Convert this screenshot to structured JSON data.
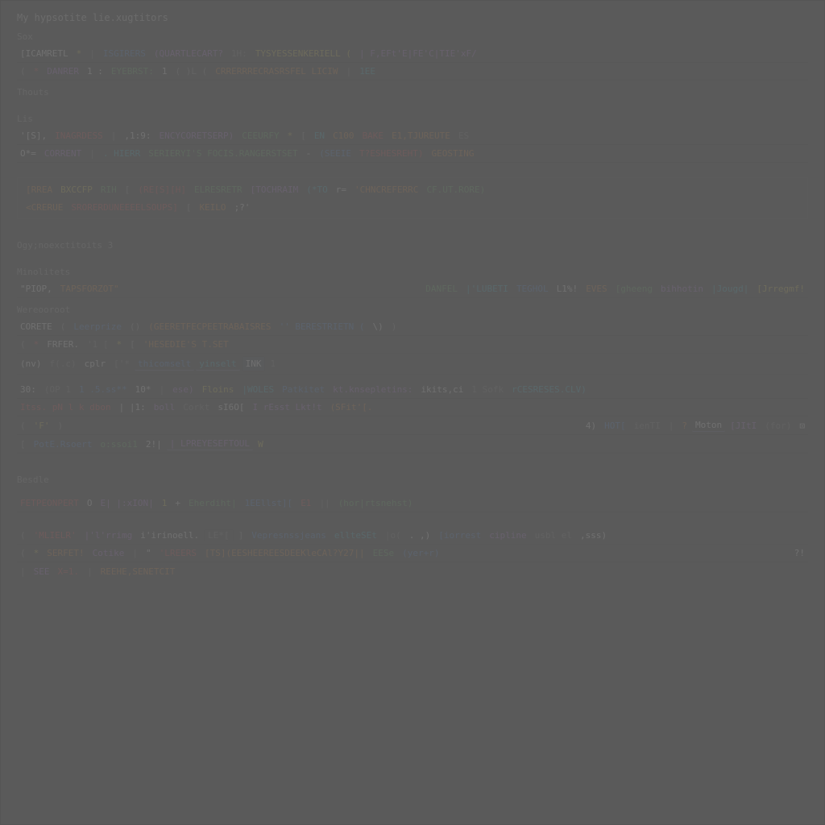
{
  "header": "My hypsotite lie.xugtitors",
  "sections": {
    "sox": "Sox",
    "sox_lines": [
      [
        {
          "t": "[ICAMRETL",
          "c": "t-white"
        },
        {
          "t": "*",
          "c": "t-yellow"
        },
        {
          "t": "|",
          "c": "t-gray"
        },
        {
          "t": "ISGIRERS",
          "c": "t-blue"
        },
        {
          "t": "(QUARTLECART?",
          "c": "t-purple"
        },
        {
          "t": "1H:",
          "c": "t-gray"
        },
        {
          "t": "TYSYESSENKERIELL (",
          "c": "t-yellow"
        },
        {
          "t": "| F,EFt'E|FE'C|TIE'xF/",
          "c": "t-purple"
        }
      ],
      [
        {
          "t": "(",
          "c": "paren"
        },
        {
          "t": "*",
          "c": "t-red"
        },
        {
          "t": "DANRER",
          "c": "t-purple"
        },
        {
          "t": "1 :",
          "c": "t-white"
        },
        {
          "t": "EYEBRST:",
          "c": "t-green"
        },
        {
          "t": "1",
          "c": "t-white"
        },
        {
          "t": "( )L (",
          "c": "paren"
        },
        {
          "t": "CRRERRRECRASRSFEL LICIW",
          "c": "t-orange"
        },
        {
          "t": "|",
          "c": "t-gray"
        },
        {
          "t": "1EE",
          "c": "t-cyan"
        }
      ]
    ],
    "thouts": "Thouts",
    "lis_label": "Lis",
    "lis_lines": [
      [
        {
          "t": "'[S],",
          "c": "t-white"
        },
        {
          "t": "INAGRDESS",
          "c": "t-red"
        },
        {
          "t": "|",
          "c": "t-gray"
        },
        {
          "t": ",1:9:",
          "c": "t-white"
        },
        {
          "t": "ENCYCORETSERP)",
          "c": "t-purple"
        },
        {
          "t": "CEEURFY",
          "c": "t-green"
        },
        {
          "t": "*",
          "c": "t-yellow"
        },
        {
          "t": "[",
          "c": "paren"
        },
        {
          "t": "EN",
          "c": "t-cyan"
        },
        {
          "t": "C100",
          "c": "t-orange"
        },
        {
          "t": "BAKE",
          "c": "t-red"
        },
        {
          "t": "E1,TJUREUTE",
          "c": "t-orange"
        },
        {
          "t": "ES",
          "c": "t-gray"
        }
      ],
      [
        {
          "t": "O*=",
          "c": "t-white"
        },
        {
          "t": "CORRENT",
          "c": "t-purple"
        },
        {
          "t": "|",
          "c": "t-gray"
        },
        {
          "t": ". HIERR",
          "c": "t-cyan"
        },
        {
          "t": "SERIERYI'S FOCIS.RANGERSTSET",
          "c": "t-green"
        },
        {
          "t": "-",
          "c": "t-white"
        },
        {
          "t": "(SEEIE",
          "c": "t-blue"
        },
        {
          "t": "T?ESHESREHT)",
          "c": "t-red"
        },
        {
          "t": "GEOSTING",
          "c": "t-orange"
        }
      ]
    ],
    "highlighted_block": [
      [
        {
          "t": "[RREA",
          "c": "t-orange"
        },
        {
          "t": "BXCCFP",
          "c": "t-yellow"
        },
        {
          "t": "RIH",
          "c": "t-green"
        },
        {
          "t": "[",
          "c": "paren"
        },
        {
          "t": "(RE[S][H]",
          "c": "t-red"
        },
        {
          "t": "ELRESRETR",
          "c": "t-green"
        },
        {
          "t": "[TOCHRAIM",
          "c": "t-purple"
        },
        {
          "t": "(*TO",
          "c": "t-cyan"
        },
        {
          "t": "r=",
          "c": "t-white"
        },
        {
          "t": "'CHNCREFERRC",
          "c": "t-orange"
        },
        {
          "t": "CF.UT.RORE)",
          "c": "t-green"
        }
      ],
      [
        {
          "t": "<CRERUE",
          "c": "t-orange"
        },
        {
          "t": "SRORERDUNEEEELSOUPS]",
          "c": "t-red"
        },
        {
          "t": "[",
          "c": "paren"
        },
        {
          "t": "KEILO",
          "c": "t-orange"
        },
        {
          "t": ";?'",
          "c": "t-white"
        }
      ]
    ],
    "ognexctions": "Ogy;noexctitoits 3",
    "mnoilets": "Minolitets",
    "mnoilets_lines": [
      [
        {
          "t": "\"PIOP,",
          "c": "t-white"
        },
        {
          "t": "TAPSFORZOT\"",
          "c": "t-orange"
        },
        {
          "t": "DANFEL",
          "c": "t-green",
          "right": true
        },
        {
          "t": "|'LUBETI",
          "c": "t-cyan"
        },
        {
          "t": "TEGHOL",
          "c": "t-blue"
        },
        {
          "t": "L1%!",
          "c": "t-white"
        },
        {
          "t": "EVES",
          "c": "t-orange"
        },
        {
          "t": "[gheeng",
          "c": "t-green"
        },
        {
          "t": "bihhotin",
          "c": "t-purple"
        },
        {
          "t": "|Jougd|",
          "c": "t-cyan"
        },
        {
          "t": "[Jrregmf!",
          "c": "t-yellow"
        }
      ]
    ],
    "weroorook": "Wereooroot",
    "weroorook_line": [
      {
        "t": "CORETE",
        "c": "t-white"
      },
      {
        "t": "(",
        "c": "paren"
      },
      {
        "t": "Leerprize",
        "c": "t-blue"
      },
      {
        "t": "()",
        "c": "paren"
      },
      {
        "t": "(GEERETFECPEETRABAISRES",
        "c": "t-orange"
      },
      {
        "t": "'' BERESTRIETN (",
        "c": "t-blue"
      },
      {
        "t": "\\)",
        "c": "t-white"
      },
      {
        "t": ")",
        "c": "paren"
      }
    ],
    "morelines": [
      [
        {
          "t": "(",
          "c": "paren"
        },
        {
          "t": "*",
          "c": "t-red"
        },
        {
          "t": "FRFER.",
          "c": "t-white"
        },
        {
          "t": "'1 [",
          "c": "t-gray"
        },
        {
          "t": "*",
          "c": "t-yellow"
        },
        {
          "t": "[",
          "c": "paren"
        },
        {
          "t": "'HESEDIE'S T.SET",
          "c": "t-orange"
        }
      ],
      [
        {
          "t": "(nv)",
          "c": "t-white"
        },
        {
          "t": "f(.c)",
          "c": "t-gray"
        },
        {
          "t": "cplr",
          "c": "t-white"
        },
        {
          "t": "['*",
          "c": "t-gray box"
        },
        {
          "t": "thicomselt",
          "c": "t-blue t-underline"
        },
        {
          "t": "yinselt",
          "c": "t-cyan t-underline"
        },
        {
          "t": "INK",
          "c": "t-white t-box",
          "highlight": true
        },
        {
          "t": "1",
          "c": "t-gray"
        }
      ]
    ],
    "midlines": [
      [
        {
          "t": "30:",
          "c": "t-white"
        },
        {
          "t": "(OP 1",
          "c": "t-gray"
        },
        {
          "t": "1 .5.ss**",
          "c": "t-blue"
        },
        {
          "t": "10*",
          "c": "t-white"
        },
        {
          "t": "|",
          "c": "t-gray"
        },
        {
          "t": "ese)",
          "c": "t-purple"
        },
        {
          "t": "Floins",
          "c": "t-yellow"
        },
        {
          "t": "|WOLES",
          "c": "t-cyan"
        },
        {
          "t": "Patkitet",
          "c": "t-blue"
        },
        {
          "t": "kt.knsepletins:",
          "c": "t-purple"
        },
        {
          "t": "ikits,ci",
          "c": "t-white"
        },
        {
          "t": "1 Sofk",
          "c": "t-gray"
        },
        {
          "t": "rCESRESES.CLV)",
          "c": "t-cyan"
        }
      ],
      [
        {
          "t": "Itss. pN l k dbon",
          "c": "t-red"
        },
        {
          "t": "| |1:",
          "c": "t-white"
        },
        {
          "t": "boll",
          "c": "t-purple"
        },
        {
          "t": "Corkt",
          "c": "t-gray"
        },
        {
          "t": "sI6O[",
          "c": "t-white"
        },
        {
          "t": "I rEsst Lkt!t",
          "c": "t-purple"
        },
        {
          "t": "(SFit'[.",
          "c": "t-orange"
        }
      ],
      [
        {
          "t": "(",
          "c": "paren"
        },
        {
          "t": "'F'",
          "c": "t-yellow"
        },
        {
          "t": ")",
          "c": "paren"
        },
        {
          "t": "4)",
          "c": "t-white",
          "right": true
        },
        {
          "t": "HOT[",
          "c": "t-blue"
        },
        {
          "t": "ienTI",
          "c": "t-gray"
        },
        {
          "t": "|",
          "c": "t-gray"
        },
        {
          "t": "?",
          "c": "t-orange"
        },
        {
          "t": "Moton",
          "c": "t-white t-underline"
        },
        {
          "t": "[JItI",
          "c": "t-purple"
        },
        {
          "t": "(for)",
          "c": "t-gray"
        },
        {
          "t": "⊡",
          "c": "t-white icon",
          "icon": true
        }
      ],
      [
        {
          "t": "[",
          "c": "paren"
        },
        {
          "t": "PotE.Rsoert",
          "c": "t-blue"
        },
        {
          "t": "o:ssoi1",
          "c": "t-green"
        },
        {
          "t": "2!|",
          "c": "t-white"
        },
        {
          "t": "| LPREYESEFTOUL",
          "c": "t-purple t-underline"
        },
        {
          "t": "W",
          "c": "t-yellow"
        }
      ]
    ],
    "besdle": "Besdle",
    "besdle_line": [
      {
        "t": "FETPEONPERT",
        "c": "t-red"
      },
      {
        "t": "O",
        "c": "t-white"
      },
      {
        "t": "E| |:xION|",
        "c": "t-purple"
      },
      {
        "t": "1",
        "c": "t-yellow"
      },
      {
        "t": "+",
        "c": "t-white"
      },
      {
        "t": "Eherdiht|",
        "c": "t-green"
      },
      {
        "t": "1EEllst][",
        "c": "t-blue"
      },
      {
        "t": "E1",
        "c": "t-red"
      },
      {
        "t": "||",
        "c": "t-gray"
      },
      {
        "t": "(hor|rtsnehst)",
        "c": "t-green"
      }
    ],
    "bottom_lines": [
      [
        {
          "t": "(",
          "c": "paren"
        },
        {
          "t": "'MLIELR'",
          "c": "t-red"
        },
        {
          "t": "|'l'rrimg",
          "c": "t-purple"
        },
        {
          "t": "i'irinoell.",
          "c": "t-white"
        },
        {
          "t": "LE*[",
          "c": "t-gray t-box"
        },
        {
          "t": "]",
          "c": "paren"
        },
        {
          "t": "Vepresnssjeans",
          "c": "t-blue"
        },
        {
          "t": "ellteSEt",
          "c": "t-cyan"
        },
        {
          "t": "|o(",
          "c": "t-gray"
        },
        {
          "t": ". ,)",
          "c": "t-white"
        },
        {
          "t": "[iorrest",
          "c": "t-blue"
        },
        {
          "t": "cipline",
          "c": "t-purple"
        },
        {
          "t": "usbl el",
          "c": "t-gray"
        },
        {
          "t": ",sss)",
          "c": "t-white"
        }
      ],
      [
        {
          "t": "(",
          "c": "paren"
        },
        {
          "t": "*",
          "c": "t-yellow"
        },
        {
          "t": "SERFET!",
          "c": "t-orange"
        },
        {
          "t": "Cotike",
          "c": "t-purple"
        },
        {
          "t": "|",
          "c": "t-gray"
        },
        {
          "t": "\"",
          "c": "t-white"
        },
        {
          "t": "'LREERS",
          "c": "t-red"
        },
        {
          "t": "[TS](EESHEEREESDEEKleCAl?Y27||",
          "c": "t-orange"
        },
        {
          "t": "EESe",
          "c": "t-green"
        },
        {
          "t": "(yer+r)",
          "c": "t-blue"
        },
        {
          "t": "?!",
          "c": "t-white",
          "right": true
        }
      ],
      [
        {
          "t": "|",
          "c": "t-gray"
        },
        {
          "t": "SEE",
          "c": "t-purple"
        },
        {
          "t": "X=1.",
          "c": "t-red"
        },
        {
          "t": "|",
          "c": "t-gray"
        },
        {
          "t": "REEHE,SENETCIT",
          "c": "t-orange"
        }
      ]
    ]
  }
}
